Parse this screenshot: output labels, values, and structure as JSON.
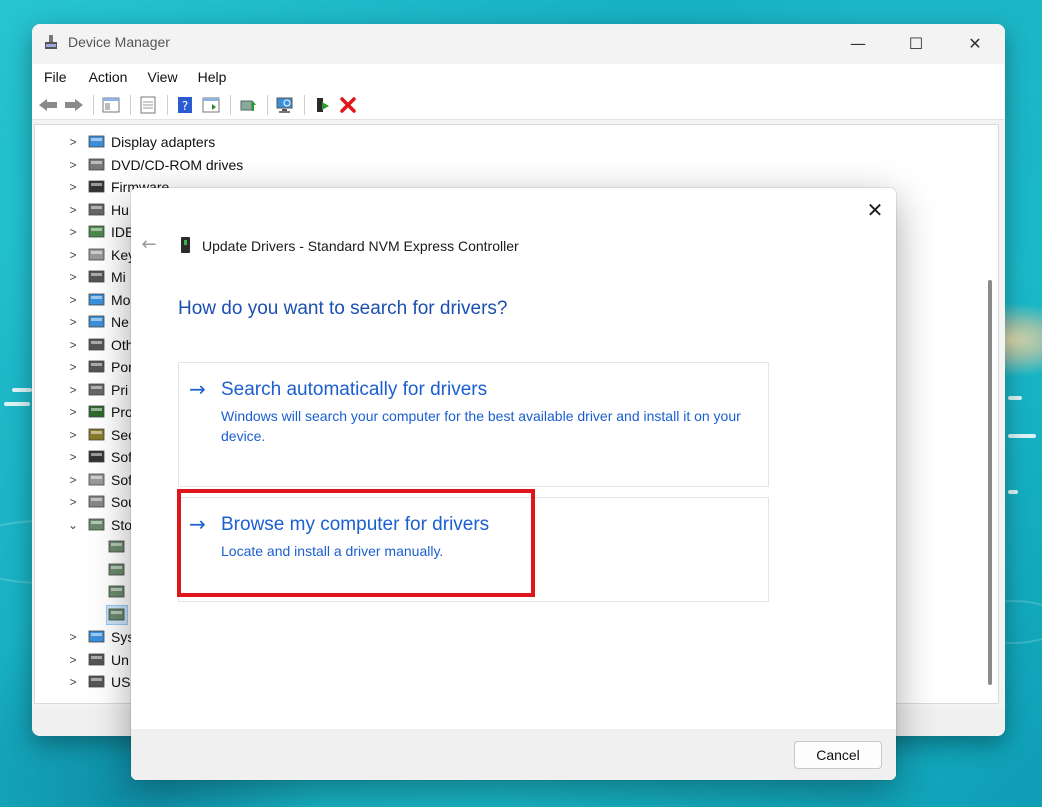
{
  "window": {
    "title": "Device Manager",
    "controls": {
      "minimize": "—",
      "maximize": "☐",
      "close": "✕"
    }
  },
  "menubar": {
    "items": [
      "File",
      "Action",
      "View",
      "Help"
    ]
  },
  "toolbar": {
    "icons": [
      "back-arrow",
      "forward-arrow",
      "show-hide-tree",
      "properties",
      "help",
      "action-pane",
      "update-driver",
      "scan-hardware",
      "enable-device",
      "uninstall-device"
    ]
  },
  "tree": {
    "items": [
      {
        "label": "Display adapters",
        "chevron": ">",
        "icon": "display-adapter"
      },
      {
        "label": "DVD/CD-ROM drives",
        "chevron": ">",
        "icon": "dvd-drive"
      },
      {
        "label": "Firmware",
        "chevron": ">",
        "icon": "firmware"
      },
      {
        "label": "Hu",
        "chevron": ">",
        "icon": "hid"
      },
      {
        "label": "IDE",
        "chevron": ">",
        "icon": "ide-controller"
      },
      {
        "label": "Key",
        "chevron": ">",
        "icon": "keyboard"
      },
      {
        "label": "Mi",
        "chevron": ">",
        "icon": "mouse"
      },
      {
        "label": "Mo",
        "chevron": ">",
        "icon": "monitor"
      },
      {
        "label": "Ne",
        "chevron": ">",
        "icon": "network"
      },
      {
        "label": "Oth",
        "chevron": ">",
        "icon": "other-devices"
      },
      {
        "label": "Por",
        "chevron": ">",
        "icon": "ports"
      },
      {
        "label": "Pri",
        "chevron": ">",
        "icon": "print-queues"
      },
      {
        "label": "Pro",
        "chevron": ">",
        "icon": "processors"
      },
      {
        "label": "Sec",
        "chevron": ">",
        "icon": "security"
      },
      {
        "label": "Sof",
        "chevron": ">",
        "icon": "software-component"
      },
      {
        "label": "Sof",
        "chevron": ">",
        "icon": "software-device"
      },
      {
        "label": "Sou",
        "chevron": ">",
        "icon": "sound"
      },
      {
        "label": "Sto",
        "chevron": "⌄",
        "icon": "storage-controller"
      }
    ],
    "storage_children_count_icons": [
      "storage-child",
      "storage-child",
      "storage-child",
      "storage-child-selected"
    ],
    "items_after": [
      {
        "label": "Sys",
        "chevron": ">",
        "icon": "system-devices"
      },
      {
        "label": "Un",
        "chevron": ">",
        "icon": "usb-universal"
      },
      {
        "label": "US",
        "chevron": ">",
        "icon": "usb"
      }
    ]
  },
  "dialog": {
    "close": "✕",
    "back": "←",
    "title": "Update Drivers - Standard NVM Express Controller",
    "heading": "How do you want to search for drivers?",
    "options": [
      {
        "arrow": "→",
        "title": "Search automatically for drivers",
        "description": "Windows will search your computer for the best available driver and install it on your device."
      },
      {
        "arrow": "→",
        "title": "Browse my computer for drivers",
        "description": "Locate and install a driver manually."
      }
    ],
    "cancel_label": "Cancel",
    "highlight_color": "#e0161b",
    "accent_color": "#1b5fd1"
  }
}
